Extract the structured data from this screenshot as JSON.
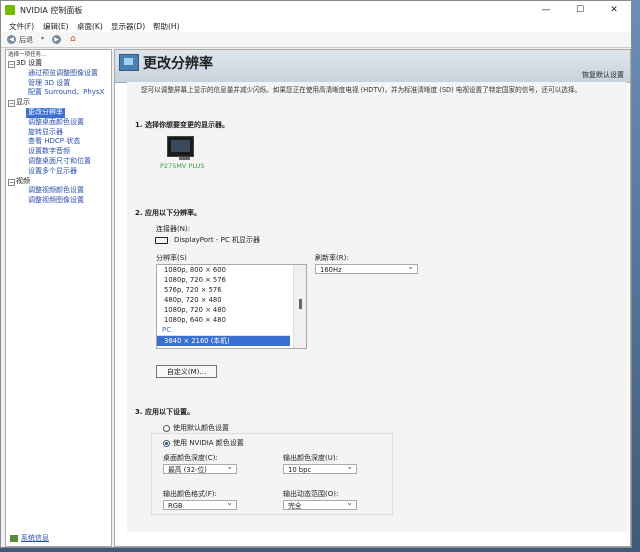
{
  "window": {
    "title": "NVIDIA 控制面板",
    "controls": {
      "minimize": "—",
      "maximize": "☐",
      "close": "✕"
    }
  },
  "menu": [
    "文件(F)",
    "编辑(E)",
    "桌面(K)",
    "显示器(D)",
    "帮助(H)"
  ],
  "toolbar": {
    "back_label": "后退",
    "back_icon": "back-arrow-icon",
    "forward_icon": "forward-arrow-icon",
    "home_icon": "home-icon"
  },
  "sidebar": {
    "task_header": "选择一项任务...",
    "tree": [
      {
        "label": "3D 设置",
        "items": [
          "通过预览调整图像设置",
          "管理 3D 设置",
          "配置 Surround、PhysX"
        ]
      },
      {
        "label": "显示",
        "items": [
          "更改分辨率",
          "调整桌面颜色设置",
          "旋转显示器",
          "查看 HDCP 状态",
          "设置数字音频",
          "调整桌面尺寸和位置",
          "设置多个显示器"
        ]
      },
      {
        "label": "视频",
        "items": [
          "调整视频颜色设置",
          "调整视频图像设置"
        ]
      }
    ],
    "selected": "更改分辨率",
    "system_info": "系统信息"
  },
  "page": {
    "title": "更改分辨率",
    "restore_defaults": "恢复默认设置",
    "description": "您可以调整屏幕上显示的信息量并减少闪烁。如果您正在使用高清晰度电视 (HDTV)，并为标准清晰度 (SD) 电视设置了特定国家的信号，还可以选择。",
    "section1": {
      "title": "1. 选择你想要变更的显示器。",
      "monitor_name": "P275MV PLUS"
    },
    "section2": {
      "title": "2. 应用以下分辨率。",
      "connector_label": "连接器(N):",
      "connector_value": "DisplayPort - PC 机显示器",
      "resolution_label": "分辨率(S)",
      "resolutions": [
        "1080p, 800 × 600",
        "1080p, 720 × 576",
        "576p, 720 × 576",
        "480p, 720 × 480",
        "1080p, 720 × 480",
        "1080p, 640 × 480"
      ],
      "group_label": "PC",
      "selected_resolution": "3840 × 2160 (本机)",
      "refresh_label": "刷新率(R):",
      "refresh_value": "160Hz",
      "custom_button": "自定义(M)..."
    },
    "section3": {
      "title": "3. 应用以下设置。",
      "radio_default": "使用默认颜色设置",
      "radio_nvidia": "使用 NVIDIA 颜色设置",
      "selected_radio": "nvidia",
      "desktop_depth_label": "桌面颜色深度(C):",
      "desktop_depth_value": "最高 (32-位)",
      "output_depth_label": "输出颜色深度(U):",
      "output_depth_value": "10 bpc",
      "output_format_label": "输出颜色格式(F):",
      "output_format_value": "RGB",
      "output_range_label": "输出动态范围(O):",
      "output_range_value": "完全"
    }
  }
}
